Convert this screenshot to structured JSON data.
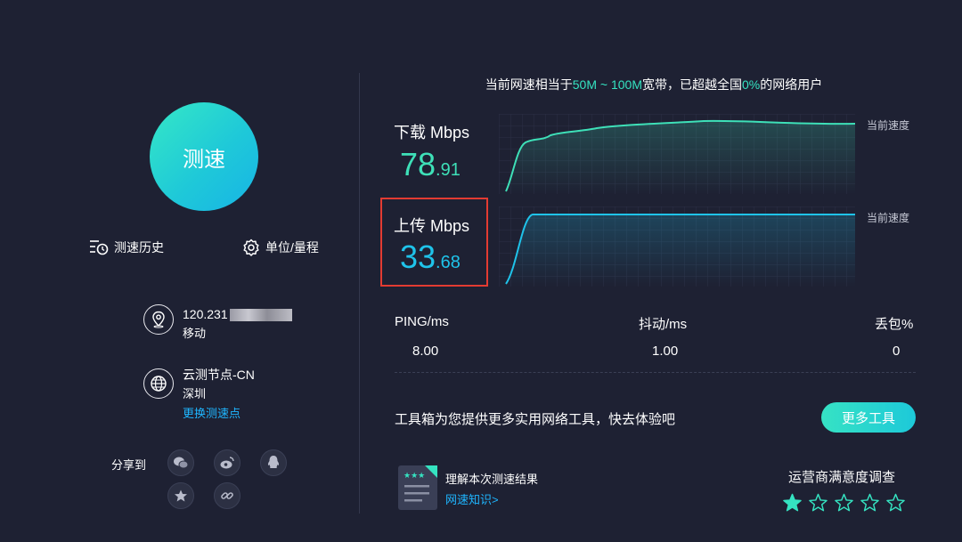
{
  "left": {
    "test_button_label": "测速",
    "history_label": "测速历史",
    "unit_label": "单位/量程",
    "ip": {
      "address_visible": "120.231",
      "carrier": "移动"
    },
    "node": {
      "name": "云测节点-CN",
      "city": "深圳",
      "change_link": "更换测速点"
    },
    "share_label": "分享到",
    "share_icons": [
      "wechat-icon",
      "weibo-icon",
      "qq-icon",
      "favorite-icon",
      "link-icon"
    ]
  },
  "headline": {
    "prefix": "当前网速相当于",
    "range": "50M ~ 100M",
    "middle": "宽带，已超越全国",
    "percent": "0%",
    "suffix": "的网络用户"
  },
  "download": {
    "label": "下载 Mbps",
    "value_int": "78",
    "value_dec": ".91",
    "speed_tag": "当前速度",
    "color": "#3ee0b8"
  },
  "upload": {
    "label": "上传 Mbps",
    "value_int": "33",
    "value_dec": ".68",
    "speed_tag": "当前速度",
    "color": "#1fc3ea"
  },
  "stats": {
    "ping_label": "PING/ms",
    "ping_value": "8.00",
    "jitter_label": "抖动/ms",
    "jitter_value": "1.00",
    "loss_label": "丢包%",
    "loss_value": "0"
  },
  "tools": {
    "text": "工具箱为您提供更多实用网络工具，快去体验吧",
    "button": "更多工具"
  },
  "understand": {
    "title": "理解本次测速结果",
    "link": "网速知识>"
  },
  "survey": {
    "title": "运营商满意度调查",
    "rating": 1,
    "max": 5
  },
  "colors": {
    "background": "#1e2133",
    "accent": "#35e3c1",
    "link": "#1fb6ff",
    "highlight_box": "#e33b32"
  }
}
